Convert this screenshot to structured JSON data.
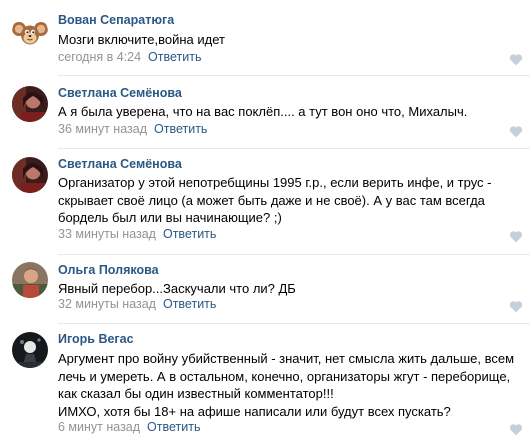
{
  "comments": [
    {
      "author": "Вован Сепаратюга",
      "lines": [
        "Мозги включите,война идет"
      ],
      "time": "сегодня в 4:24",
      "reply": "Ответить",
      "avatar_icon": "cheburashka-avatar-icon"
    },
    {
      "author": "Светлана Семёнова",
      "lines": [
        "А я была уверена, что на вас поклёп.... а тут вон оно что, Михалыч."
      ],
      "time": "36 минут назад",
      "reply": "Ответить",
      "avatar_icon": "user-photo-avatar-icon"
    },
    {
      "author": "Светлана Семёнова",
      "lines": [
        "Организатор у этой непотребщины 1995 г.р., если верить инфе, и трус -",
        "скрывает своё лицо (а может быть даже и не своё). А у вас там всегда",
        "бордель был или вы начинающие? ;)"
      ],
      "time": "33 минуты назад",
      "reply": "Ответить",
      "avatar_icon": "user-photo-avatar-icon"
    },
    {
      "author": "Ольга Полякова",
      "lines": [
        "Явный перебор...Заскучали что ли? ДБ"
      ],
      "time": "32 минуты назад",
      "reply": "Ответить",
      "avatar_icon": "user-photo-avatar-icon"
    },
    {
      "author": "Игорь Вегас",
      "lines": [
        "Аргумент про войну убийственный - значит, нет смысла жить дальше, всем",
        "лечь и умереть. А в остальном, конечно, организаторы жгут - переборище,",
        "как сказал бы один известный комментатор!!!",
        "ИМХО, хотя бы 18+ на афише написали или будут всех пускать?"
      ],
      "time": "6 минут назад",
      "reply": "Ответить",
      "avatar_icon": "user-photo-avatar-icon"
    }
  ],
  "colors": {
    "author": "#2a5885",
    "reply": "#2a5885",
    "time": "#939393",
    "like": "#c5d0db",
    "divider": "#e7e8ec"
  },
  "icons": {
    "like": "heart-icon"
  }
}
